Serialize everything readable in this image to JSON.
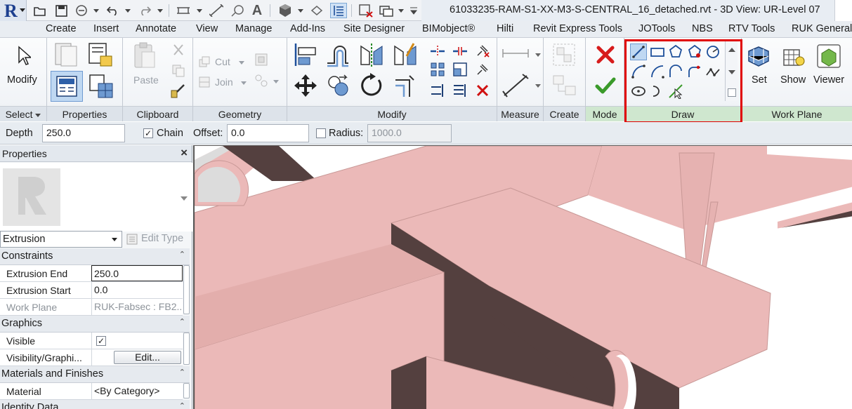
{
  "title_bar": {
    "file_title": "61033235-RAM-S1-XX-M3-S-CENTRAL_16_detached.rvt - 3D View: UR-Level 07",
    "app_logo": "R"
  },
  "quick_access_icons": [
    "open-icon",
    "save-icon",
    "sync-icon",
    "undo-icon",
    "redo-icon",
    "measure-icon",
    "dimension-icon",
    "tag-icon",
    "text-icon",
    "3d-view-icon",
    "section-icon",
    "thin-lines-icon",
    "close-hidden-icon",
    "switch-windows-icon",
    "customize-icon"
  ],
  "tabs": [
    "Create",
    "Insert",
    "Annotate",
    "View",
    "Manage",
    "Add-Ins",
    "Site Designer",
    "BIMobject®",
    "Hilti",
    "Revit Express Tools",
    "JOTools",
    "NBS",
    "RTV Tools",
    "RUK General"
  ],
  "ribbon": {
    "select": {
      "label": "Select",
      "modify": "Modify"
    },
    "properties": {
      "label": "Properties"
    },
    "clipboard": {
      "label": "Clipboard",
      "paste": "Paste"
    },
    "geometry": {
      "label": "Geometry",
      "cut": "Cut",
      "join": "Join"
    },
    "modify": {
      "label": "Modify"
    },
    "measure": {
      "label": "Measure"
    },
    "create": {
      "label": "Create"
    },
    "mode": {
      "label": "Mode"
    },
    "draw": {
      "label": "Draw"
    },
    "work_plane": {
      "label": "Work Plane",
      "set": "Set",
      "show": "Show",
      "viewer": "Viewer"
    }
  },
  "options_bar": {
    "depth_label": "Depth",
    "depth_value": "250.0",
    "chain_label": "Chain",
    "chain_checked": "✓",
    "offset_label": "Offset:",
    "offset_value": "0.0",
    "radius_label": "Radius:",
    "radius_value": "1000.0"
  },
  "properties_palette": {
    "title": "Properties",
    "close": "×",
    "type": "Extrusion",
    "edit_type": "Edit Type",
    "sections": [
      {
        "name": "Constraints",
        "rows": [
          {
            "key": "Extrusion End",
            "value": "250.0"
          },
          {
            "key": "Extrusion Start",
            "value": "0.0"
          },
          {
            "key": "Work Plane",
            "value": "RUK-Fabsec : FB2..."
          }
        ]
      },
      {
        "name": "Graphics",
        "rows": [
          {
            "key": "Visible",
            "value": "✓"
          },
          {
            "key": "Visibility/Graphi...",
            "value": "Edit..."
          }
        ]
      },
      {
        "name": "Materials and Finishes",
        "rows": [
          {
            "key": "Material",
            "value": "<By Category>"
          }
        ]
      },
      {
        "name": "Identity Data",
        "rows": []
      }
    ]
  },
  "colors": {
    "highlight": "#e00000",
    "steel_face": "#ebb9b8",
    "steel_dark": "#54403f",
    "steel_edge": "#c79795"
  }
}
